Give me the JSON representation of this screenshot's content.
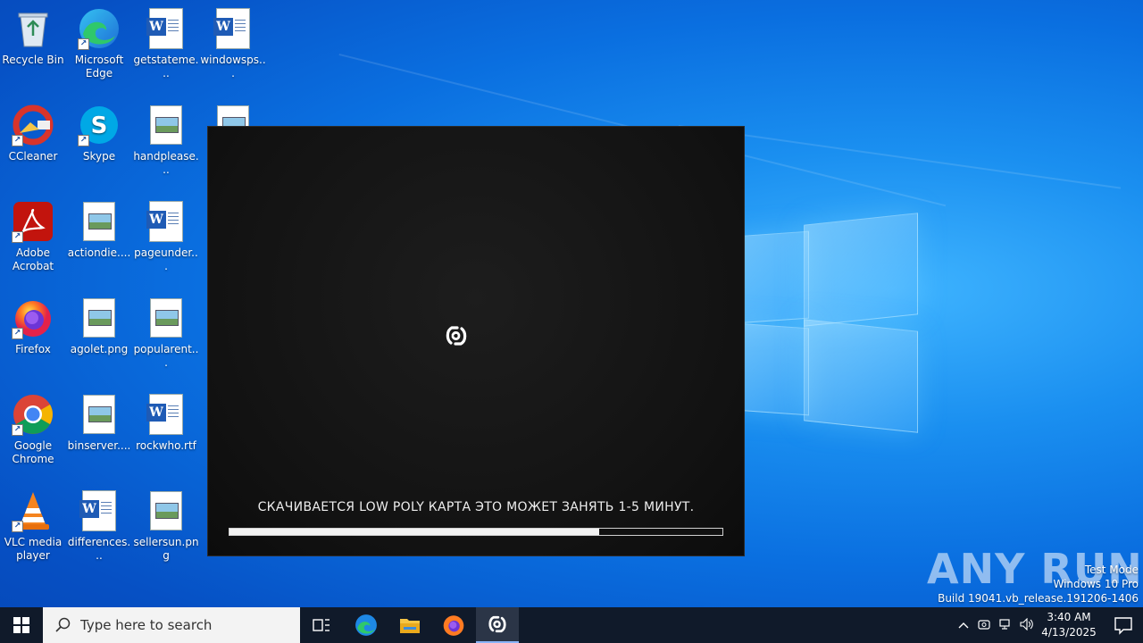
{
  "desktop": {
    "icons": [
      {
        "label": "Recycle Bin"
      },
      {
        "label": "Microsoft Edge"
      },
      {
        "label": "getstateme..."
      },
      {
        "label": "windowsps..."
      },
      {
        "label": "CCleaner"
      },
      {
        "label": "Skype"
      },
      {
        "label": "handplease..."
      },
      {
        "label": "Adobe Acrobat"
      },
      {
        "label": "actiondie...."
      },
      {
        "label": "pageunder..."
      },
      {
        "label": "Firefox"
      },
      {
        "label": "agolet.png"
      },
      {
        "label": "popularent..."
      },
      {
        "label": "Google Chrome"
      },
      {
        "label": "binserver...."
      },
      {
        "label": "rockwho.rtf"
      },
      {
        "label": "VLC media player"
      },
      {
        "label": "differences..."
      },
      {
        "label": "sellersun.png"
      }
    ]
  },
  "app": {
    "status_text": "СКАЧИВАЕТСЯ LOW POLY КАРТА ЭТО МОЖЕТ ЗАНЯТЬ 1-5 МИНУТ.",
    "progress": 0.75
  },
  "watermark": {
    "text": "ANY RUN"
  },
  "system_info": {
    "line1": "Test Mode",
    "line2": "Windows 10 Pro",
    "line3": "Build 19041.vb_release.191206-1406"
  },
  "taskbar": {
    "search_placeholder": "Type here to search",
    "time": "3:40 AM",
    "date": "4/13/2025"
  },
  "colors": {
    "taskbar": "#101a2a",
    "app_bg": "#121212",
    "progress_fill": "#f2f2f2"
  }
}
